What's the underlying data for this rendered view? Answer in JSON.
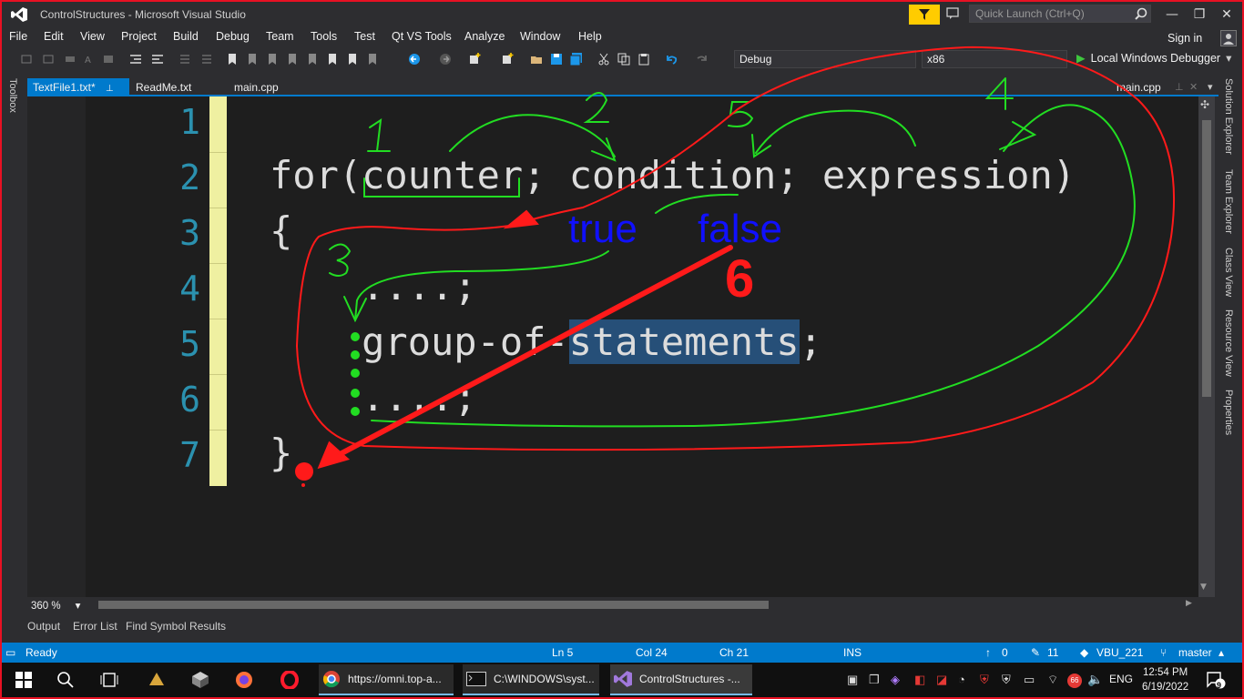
{
  "window": {
    "title": "ControlStructures - Microsoft Visual Studio",
    "quick_launch_placeholder": "Quick Launch (Ctrl+Q)",
    "min": "—",
    "max": "❐",
    "close": "✕"
  },
  "menu": {
    "items": [
      "File",
      "Edit",
      "View",
      "Project",
      "Build",
      "Debug",
      "Team",
      "Tools",
      "Test",
      "Qt VS Tools",
      "Analyze",
      "Window",
      "Help"
    ],
    "sign_in": "Sign in"
  },
  "toolbar": {
    "config": "Debug",
    "platform": "x86",
    "run_label": "Local Windows Debugger"
  },
  "side": {
    "toolbox": "Toolbox",
    "right_panels": [
      "Solution Explorer",
      "Team Explorer",
      "Class View",
      "Resource View",
      "Properties"
    ]
  },
  "tabs": {
    "active": "TextFile1.txt*",
    "pin": "⊥",
    "close": "✕",
    "others": [
      "ReadMe.txt",
      "main.cpp"
    ],
    "right_tab": "main.cpp"
  },
  "editor": {
    "line_numbers": [
      "1",
      "2",
      "3",
      "4",
      "5",
      "6",
      "7"
    ],
    "lines": [
      "",
      "for(counter; condition; expression)",
      "{",
      "    ....;",
      "    group-of-",
      "    ....;",
      "}"
    ],
    "line5_selected": "statements",
    "line5_tail": ";",
    "zoom": "360 %"
  },
  "annotations": {
    "numbers": [
      "1",
      "2",
      "3",
      "4",
      "5",
      "6"
    ],
    "true_label": "true",
    "false_label": "false"
  },
  "bottom_tabs": [
    "Output",
    "Error List",
    "Find Symbol Results"
  ],
  "status": {
    "ready": "Ready",
    "ln": "Ln 5",
    "col": "Col 24",
    "ch": "Ch 21",
    "mode": "INS",
    "up": "0",
    "edits": "11",
    "repo": "VBU_221",
    "branch": "master"
  },
  "taskbar": {
    "apps": [
      "https://omni.top-a...",
      "C:\\WINDOWS\\syst...",
      "ControlStructures -..."
    ],
    "lang": "ENG",
    "time": "12:54 PM",
    "date": "6/19/2022",
    "notif_count": "9",
    "badge": "66"
  },
  "colors": {
    "accent": "#007acc",
    "annotation_red": "#ff1a1a",
    "annotation_green": "#22dd22",
    "annotation_blue": "#1010ff"
  }
}
